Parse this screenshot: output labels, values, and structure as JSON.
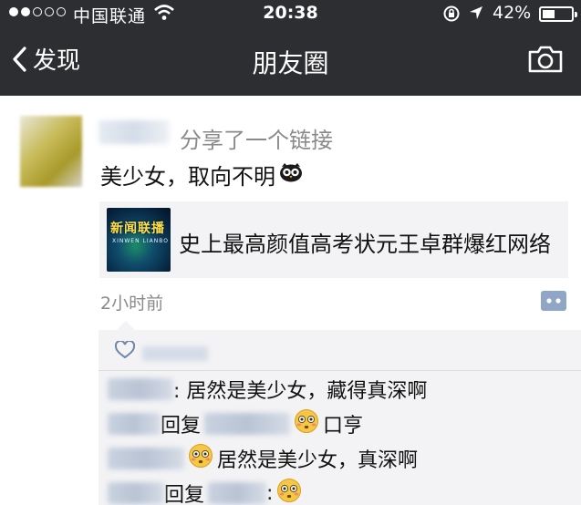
{
  "status_bar": {
    "carrier": "中国联通",
    "time": "20:38",
    "battery_percent": "42%",
    "battery_level": 0.42,
    "icons": [
      "signal-dots-icon",
      "wifi-icon",
      "rotation-lock-icon",
      "location-arrow-icon",
      "battery-icon"
    ]
  },
  "nav": {
    "back_label": "发现",
    "title": "朋友圈",
    "camera_icon": "camera-icon"
  },
  "post": {
    "action_text": "分享了一个链接",
    "text": "美少女，取向不明",
    "link": {
      "thumb_text": "新闻联播",
      "thumb_sub": "XINWEN LIANBO",
      "title": "史上最高颜值高考状元王卓群爆红网络"
    },
    "time": "2小时前"
  },
  "comments": [
    {
      "text": ": 居然是美少女，藏得真深啊"
    },
    {
      "reply_word": "回复",
      "text": "口亨"
    },
    {
      "text": "居然是美少女，真深啊"
    },
    {
      "reply_word": "回复",
      "text": ":"
    }
  ],
  "colors": {
    "nav_bg": "#2d2e32",
    "secondary_text": "#8a8a8a",
    "card_bg": "#f3f3f5",
    "comment_icon": "#8fa6c7"
  }
}
